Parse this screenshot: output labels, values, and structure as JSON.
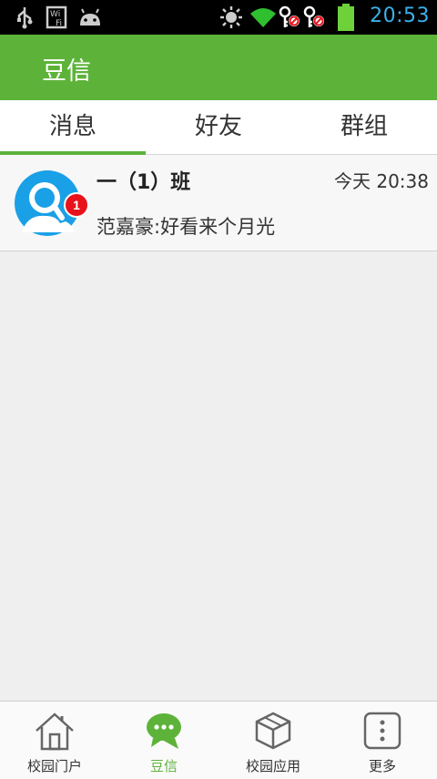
{
  "statusbar": {
    "time": "20:53",
    "icons": [
      "usb-icon",
      "wifi-file-icon",
      "android-icon",
      "brightness-icon",
      "wifi-signal-icon",
      "key-blocked-icon",
      "key-blocked-icon",
      "battery-icon"
    ]
  },
  "actionbar": {
    "title": "豆信"
  },
  "tabs": [
    {
      "label": "消息",
      "active": true
    },
    {
      "label": "好友",
      "active": false
    },
    {
      "label": "群组",
      "active": false
    }
  ],
  "conversations": [
    {
      "name": "一（1）班",
      "time": "今天 20:38",
      "message": "范嘉豪:好看来个月光",
      "unread": "1"
    }
  ],
  "bottomnav": [
    {
      "label": "校园门户",
      "icon": "house-icon",
      "active": false
    },
    {
      "label": "豆信",
      "icon": "chat-bubble-icon",
      "active": true
    },
    {
      "label": "校园应用",
      "icon": "cube-icon",
      "active": false
    },
    {
      "label": "更多",
      "icon": "more-dots-icon",
      "active": false
    }
  ],
  "colors": {
    "accent": "#5db339",
    "time": "#3bb0e8",
    "badge": "#e8121b",
    "avatar": "#1aa0e6"
  }
}
